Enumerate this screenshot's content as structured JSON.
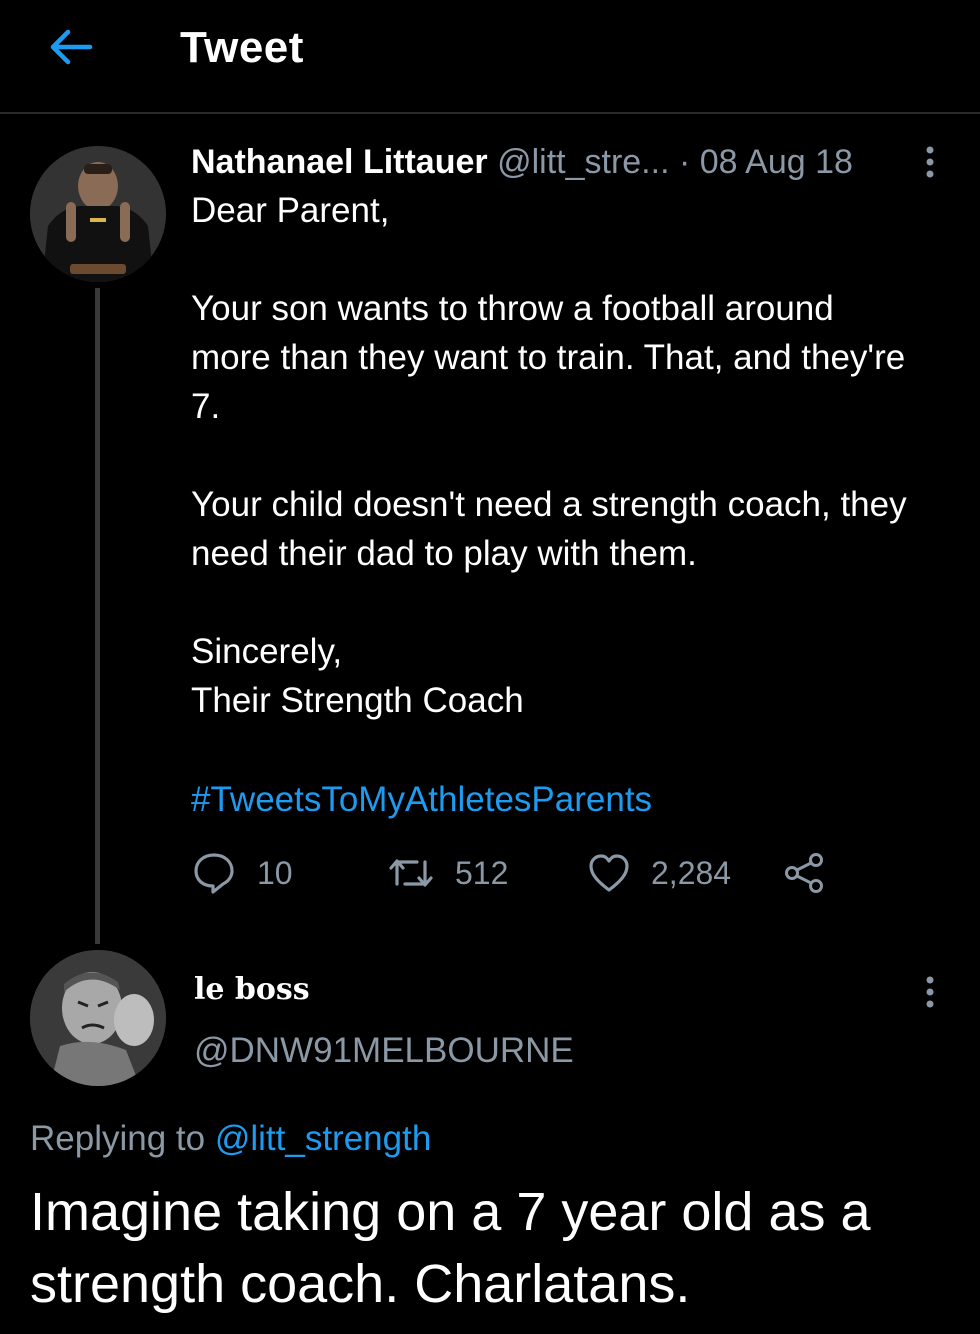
{
  "header": {
    "title": "Tweet",
    "back_icon": "arrow-left-icon",
    "accent_color": "#1d9bf0"
  },
  "tweet": {
    "author_name": "Nathanael Littauer",
    "author_handle": "@litt_stre...",
    "separator": "·",
    "date": "08 Aug 18",
    "lines": [
      "Dear Parent,",
      "Your son wants to throw a football around",
      "more than they want to train. That, and they're",
      "7.",
      "Your child doesn't need a strength coach, they",
      "need their dad to play with them.",
      "Sincerely,",
      "Their Strength Coach"
    ],
    "hashtag": "#TweetsToMyAthletesParents",
    "actions": {
      "replies": "10",
      "retweets": "512",
      "likes": "2,284"
    }
  },
  "reply": {
    "author_name": "le boss",
    "author_handle": "@DNW91MELBOURNE",
    "replying_prefix": "Replying to ",
    "replying_mention": "@litt_strength",
    "text": "Imagine taking on a 7 year old as a strength coach. Charlatans."
  }
}
